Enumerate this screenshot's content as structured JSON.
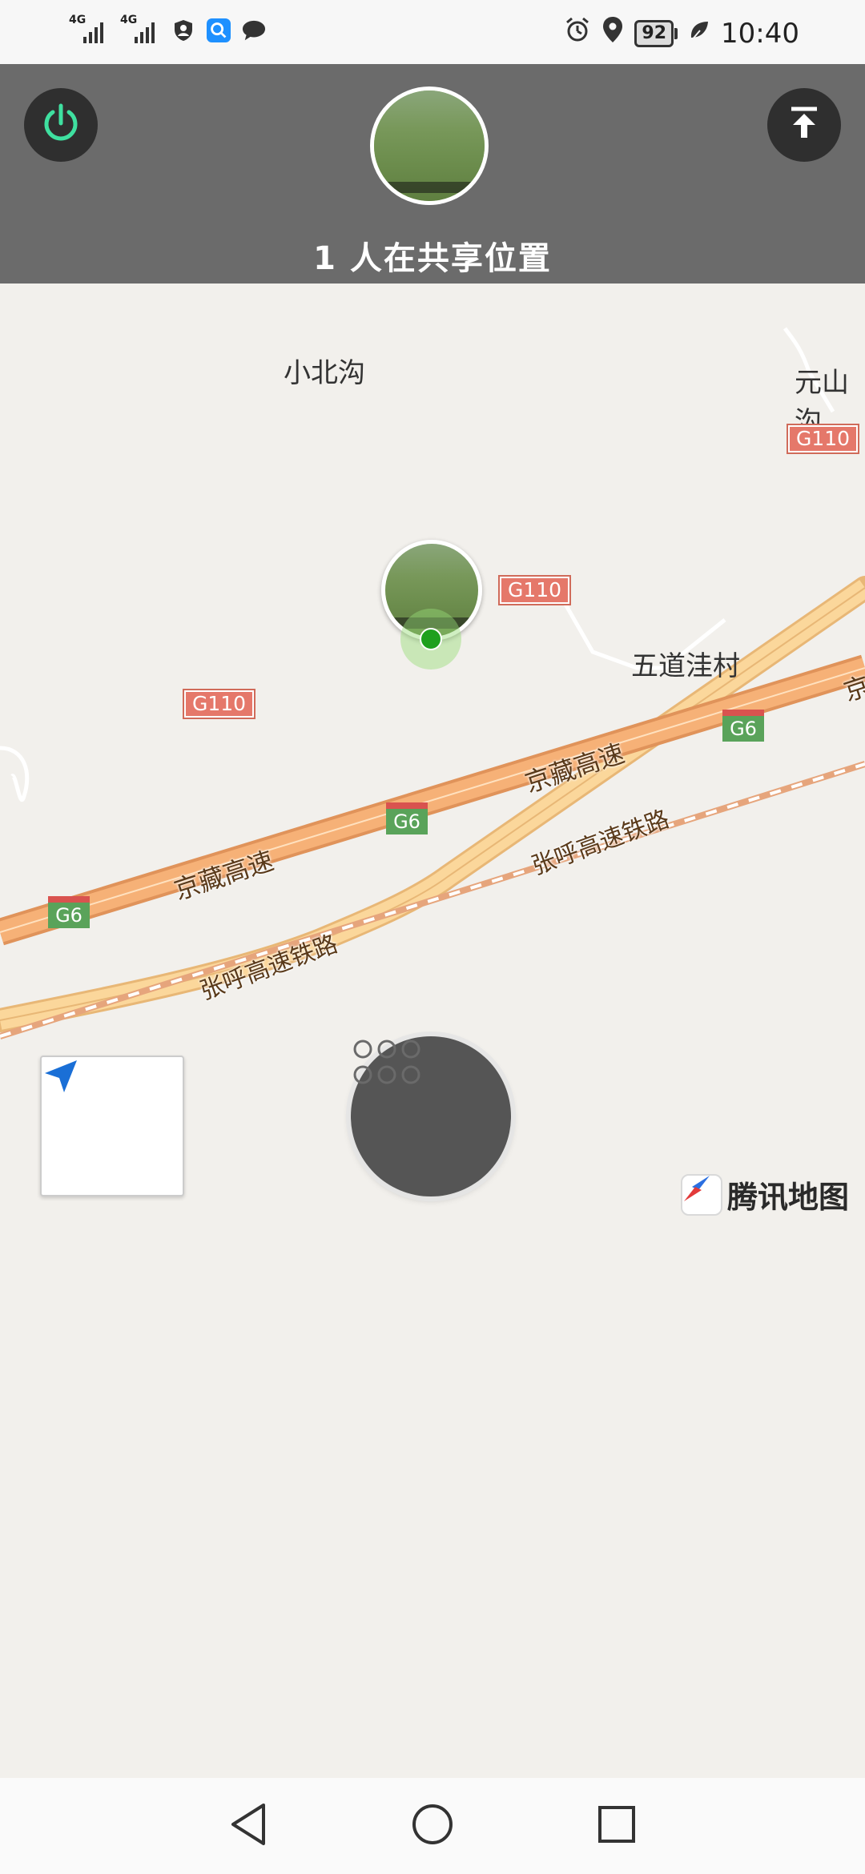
{
  "status_bar": {
    "signal_1_tag": "4G",
    "signal_2_tag": "4G",
    "battery_level": "92",
    "time": "10:40",
    "icons": [
      "signal-icon",
      "signal-icon",
      "shield-user-icon",
      "search-app-icon",
      "chat-icon",
      "alarm-icon",
      "location-pin-icon",
      "battery-icon",
      "leaf-icon"
    ]
  },
  "header": {
    "share_title": "1 人在共享位置",
    "power_icon": "power-icon",
    "upload_icon": "upload-top-icon"
  },
  "map": {
    "places": {
      "xiaobeigou": "小北沟",
      "yuanshan": "元山沟",
      "wudaowacun": "五道洼村"
    },
    "road_shields": {
      "g110_a": "G110",
      "g110_b": "G110",
      "g110_c": "G110",
      "g6_a": "G6",
      "g6_b": "G6",
      "g6_c": "G6"
    },
    "road_labels": {
      "jingzang_1": "京藏高速",
      "jingzang_2": "京藏高速",
      "jing_edge": "京"
    },
    "rail_labels": {
      "zhanghu_1": "张呼高速铁路",
      "zhanghu_2": "张呼高速铁路"
    },
    "brand": "腾讯地图",
    "colors": {
      "map_bg": "#f2f0ec",
      "highway": "#f5c98a",
      "expressway": "#f0a96b",
      "location_dot": "#1ea01e"
    }
  },
  "controls": {
    "locate_icon": "navigation-arrow-icon",
    "menu_icon": "grid-dots-icon"
  },
  "nav_bar": {
    "back_icon": "back-triangle-icon",
    "home_icon": "home-circle-icon",
    "recents_icon": "recents-square-icon"
  }
}
